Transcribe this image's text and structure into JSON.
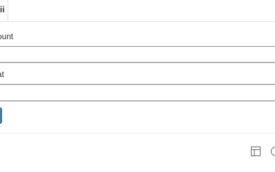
{
  "header": {
    "tab_label": "ii"
  },
  "form": {
    "field1_label": "ount",
    "field1_value": "",
    "field2_value": "",
    "field3_label": "at",
    "field3_value": "",
    "field4_value": ""
  },
  "footer": {
    "icons": [
      "table-layout-icon",
      "circle-icon"
    ]
  },
  "colors": {
    "primary_button": "#3d7eaa",
    "input_border": "#8c8c8c",
    "divider": "#e5e5e5",
    "icon": "#777777"
  }
}
